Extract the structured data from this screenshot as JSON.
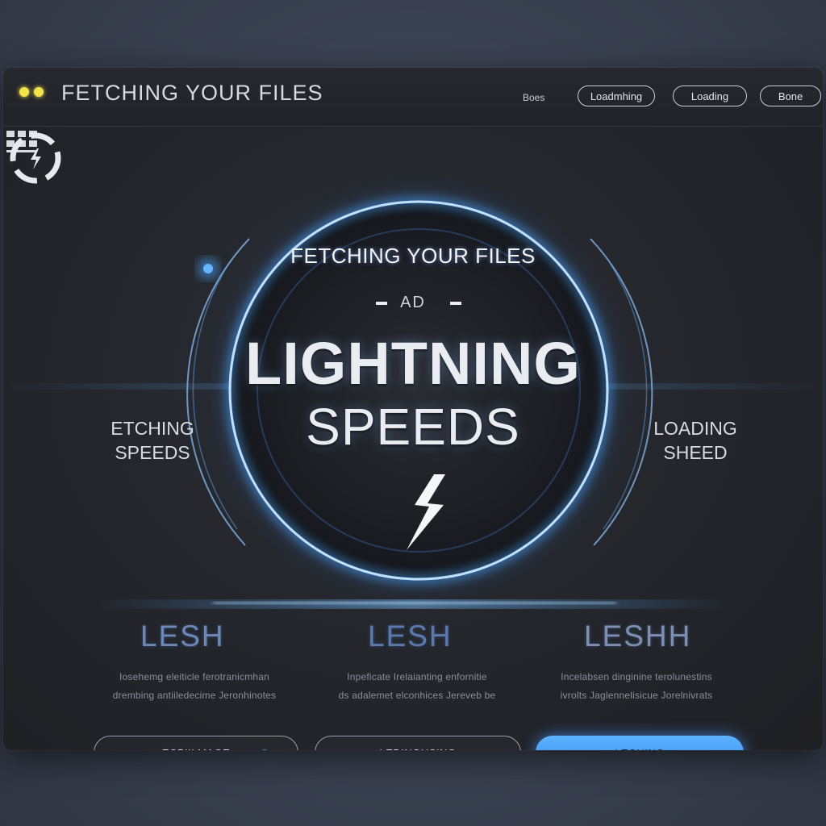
{
  "window": {
    "title": "FETCHING YOUR FILES",
    "traffic_light_color": "#f3e34a"
  },
  "nav": {
    "link": "Boes",
    "pills": [
      "Loadmhing",
      "Loading",
      "Bone"
    ]
  },
  "hero": {
    "heading": "FETCHING YOUR FILES",
    "subheading": "AD",
    "title_line1": "LIGHTNING",
    "title_line2": "SPEEDS",
    "accent_color": "#4aa8ff"
  },
  "left_panel": {
    "icon": "grid-icon",
    "line1": "ETCHING",
    "line2": "SPEEDS"
  },
  "right_panel": {
    "icon": "spinner-icon",
    "line1": "LOADING",
    "line2": "SHEED"
  },
  "features": [
    {
      "title": "LESH",
      "line1": "Iosehemg eleiticle ferotranicmhan",
      "line2": "drembing antiiledecime Jeronhinotes"
    },
    {
      "title": "LESH",
      "line1": "Inpeficate Irelaianting enfornitie",
      "line2": "ds adalemet elconhices Jereveb be"
    },
    {
      "title": "LESHH",
      "line1": "Incelabsen dinginine terolunestins",
      "line2": "ivrolts Jaglennelisicue Jorelnivrats"
    }
  ],
  "buttons": [
    "ECPIILMAGE",
    "LEDINOUSING",
    "LEGHING"
  ]
}
